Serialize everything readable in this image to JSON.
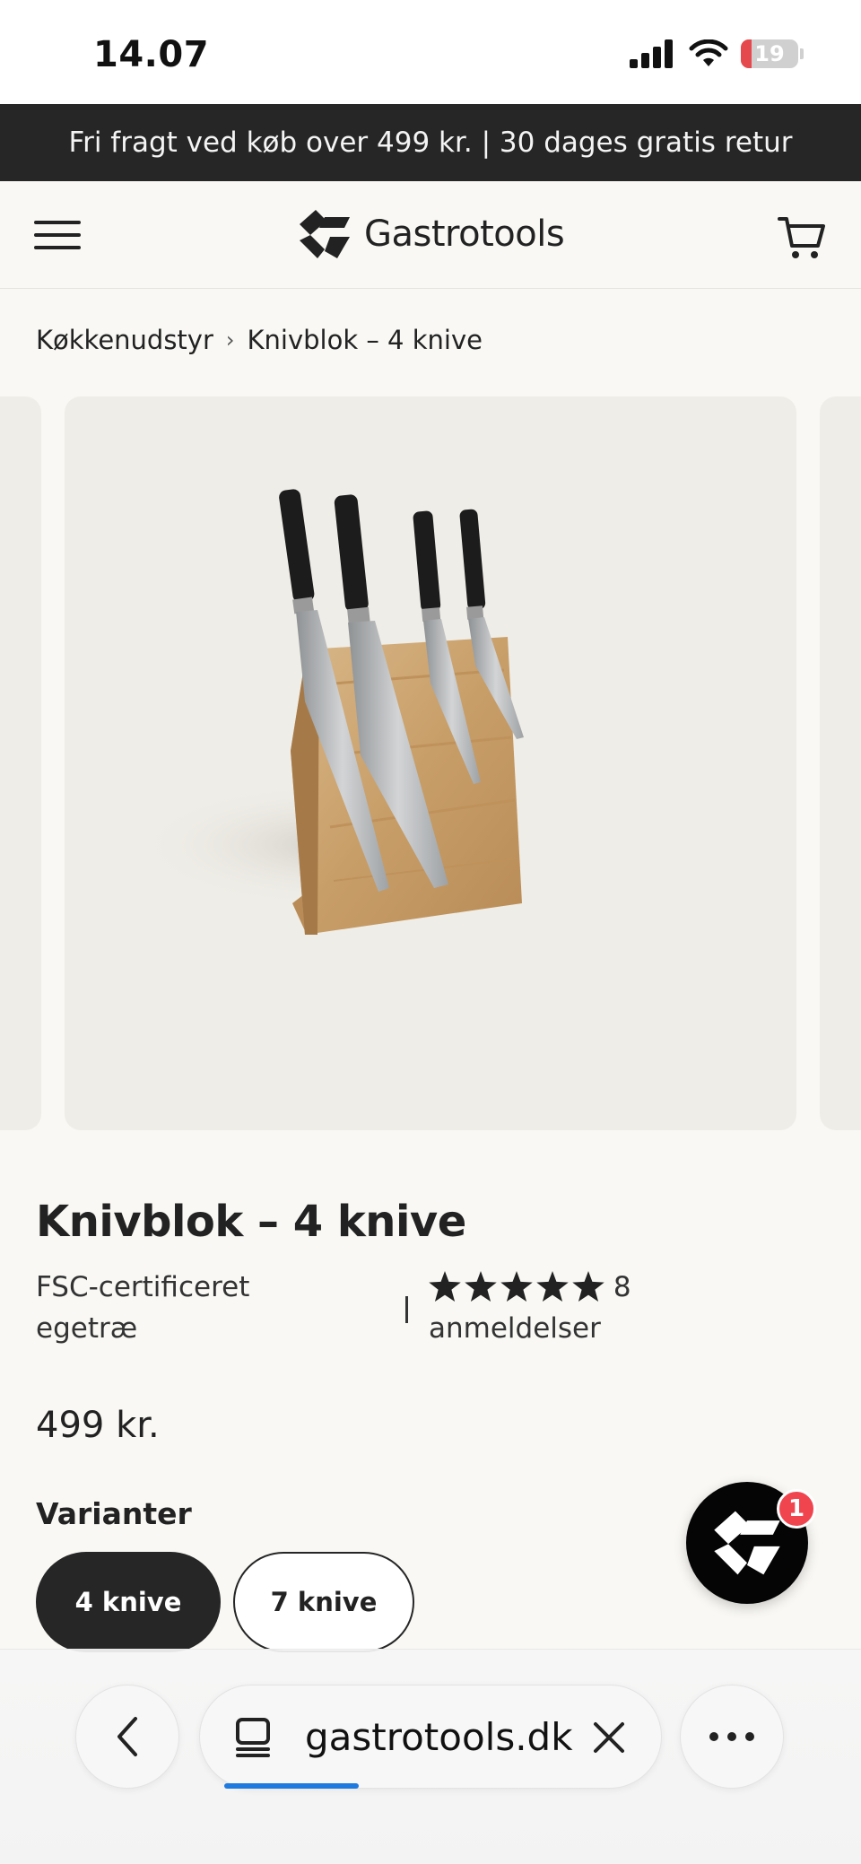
{
  "status_bar": {
    "time": "14.07",
    "battery_level": "19",
    "icons": [
      "cellular-signal-icon",
      "wifi-icon",
      "battery-icon"
    ]
  },
  "promo": {
    "text": "Fri fragt ved køb over 499 kr. | 30 dages gratis retur"
  },
  "header": {
    "brand": "Gastrotools",
    "icons": [
      "hamburger-menu-icon",
      "gastrotools-logo-icon",
      "cart-icon"
    ]
  },
  "breadcrumb": {
    "items": [
      "Køkkenudstyr",
      "Knivblok – 4 knive"
    ],
    "separator": "›"
  },
  "gallery": {
    "image": "product-photo-knife-block"
  },
  "product": {
    "title": "Knivblok – 4 knive",
    "material": "FSC-certificeret egetræ",
    "rating_stars": 5,
    "review_count": "8",
    "review_label": "anmeldelser",
    "price": "499 kr.",
    "variants_label": "Varianter",
    "variants": [
      {
        "label": "4 knive",
        "selected": true
      },
      {
        "label": "7 knive",
        "selected": false
      }
    ]
  },
  "chat": {
    "badge_count": "1"
  },
  "browser": {
    "url": "gastrotools.dk",
    "load_progress_percent": 20,
    "icons": [
      "back-chevron-icon",
      "tabs-icon",
      "close-icon",
      "more-icon"
    ]
  },
  "colors": {
    "accent_dark": "#262626",
    "background": "#f9f8f4",
    "image_background": "#efede7",
    "badge_red": "#f0454f",
    "progress_blue": "#1f7ae0"
  }
}
